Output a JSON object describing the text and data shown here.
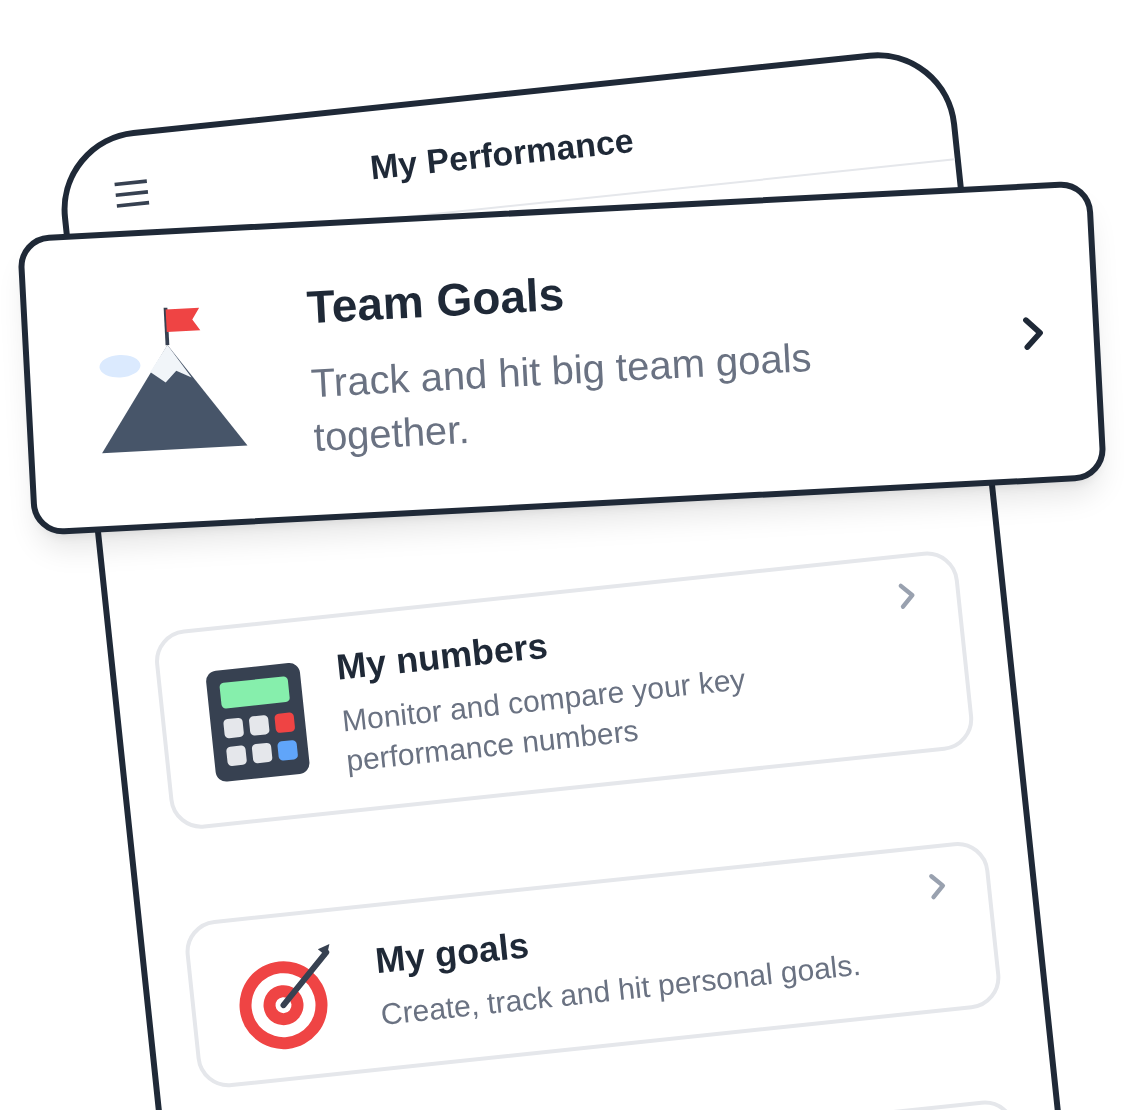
{
  "header": {
    "title": "My Performance"
  },
  "featured": {
    "title": "Team Goals",
    "description": "Track and hit big team goals together."
  },
  "items": [
    {
      "kind": "numbers",
      "title": "My numbers",
      "description": "Monitor and compare your key performance numbers"
    },
    {
      "kind": "goals",
      "title": "My goals",
      "description": "Create, track and hit personal goals."
    },
    {
      "kind": "partial"
    }
  ]
}
